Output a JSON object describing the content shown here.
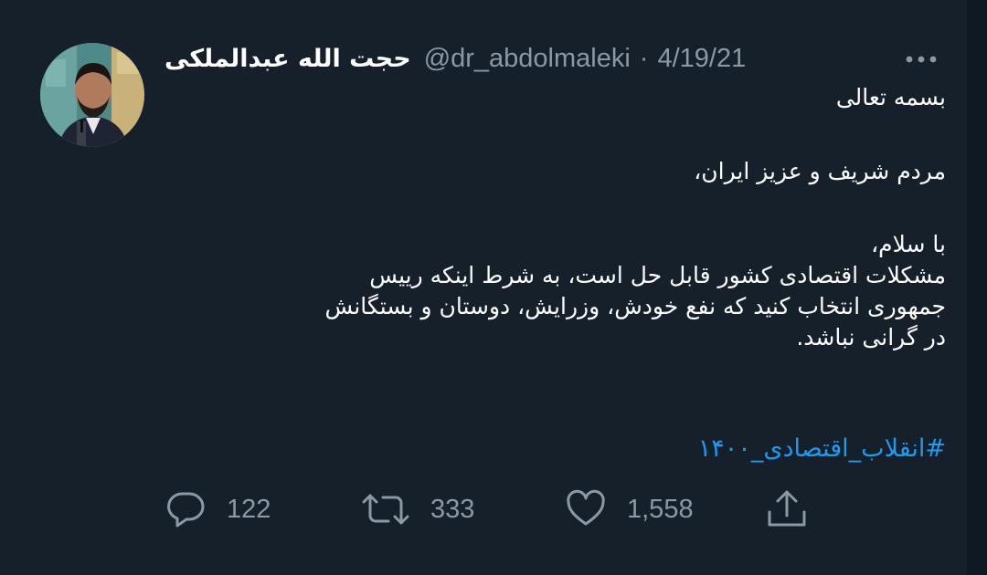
{
  "tweet": {
    "display_name": "حجت الله عبدالملکی",
    "handle": "@dr_abdolmaleki",
    "separator": "·",
    "date": "4/19/21",
    "body": {
      "line1": "بسمه تعالی",
      "line2": "مردم شریف و عزیز ایران،",
      "line3": "با سلام،",
      "line4": "مشکلات اقتصادی کشور قابل حل است، به شرط اینکه رییس",
      "line5": "جمهوری انتخاب کنید که نفع خودش، وزرایش، دوستان و بستگانش",
      "line6": "در گرانی نباشد."
    },
    "hashtag": "#انقلاب_اقتصادی_۱۴۰۰",
    "actions": {
      "reply_count": "122",
      "retweet_count": "333",
      "like_count": "1,558"
    }
  },
  "icons": {
    "more": "more-dots-icon",
    "reply": "reply-bubble-icon",
    "retweet": "retweet-icon",
    "like": "heart-icon",
    "share": "share-icon"
  },
  "colors": {
    "background": "#15202b",
    "text": "#ffffff",
    "secondary": "#8b98a5",
    "link": "#1d9bf0"
  }
}
